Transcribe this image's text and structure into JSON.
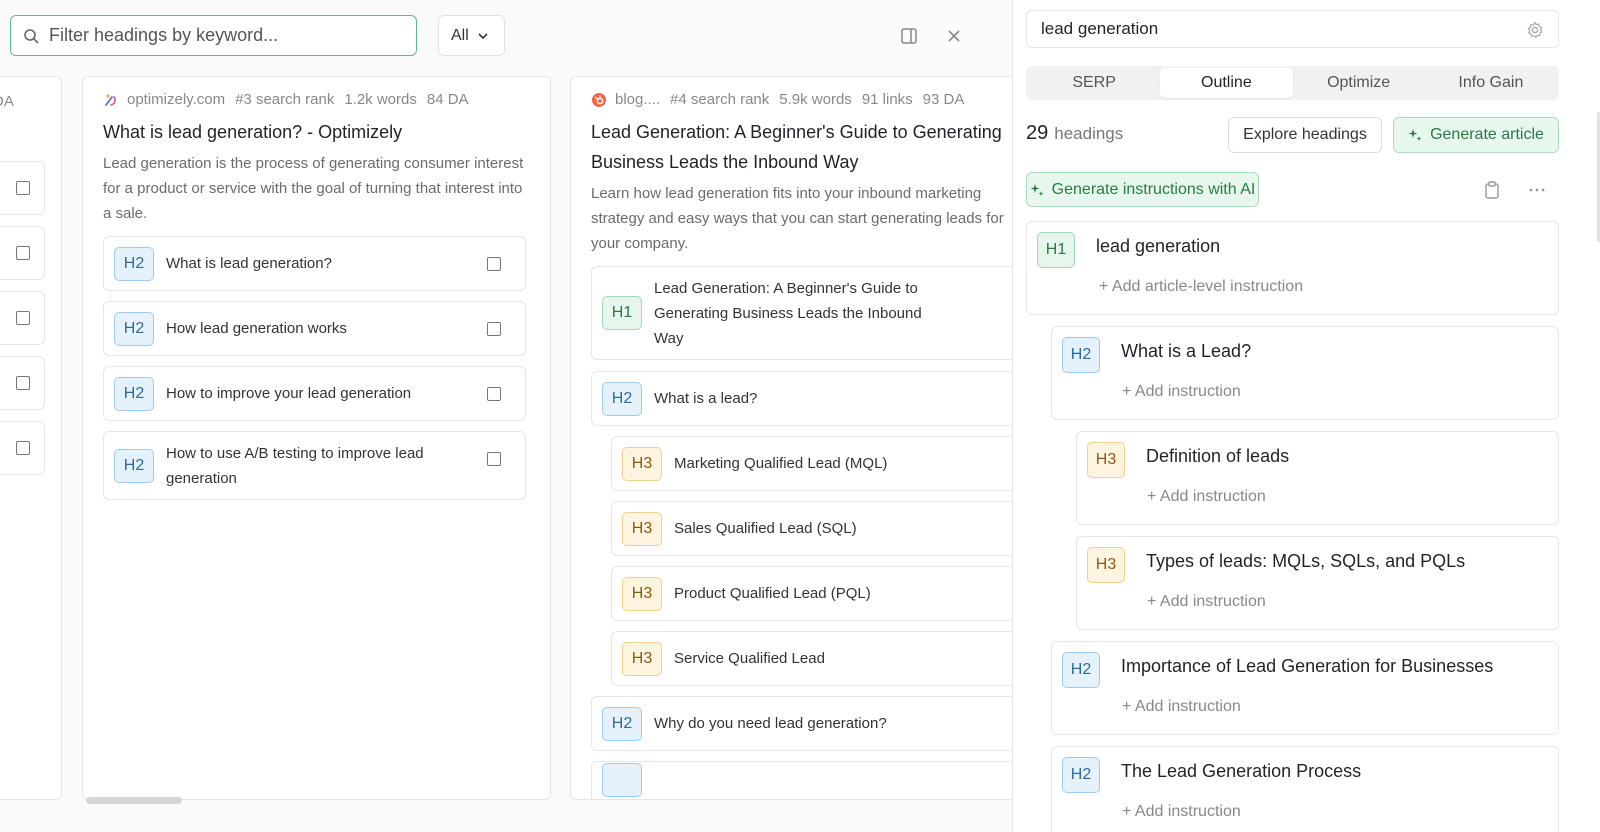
{
  "search": {
    "placeholder": "Filter headings by keyword...",
    "value": ""
  },
  "filter": {
    "selected": "All"
  },
  "stub_card": {
    "meta_fragment": "DA"
  },
  "sources": [
    {
      "domain": "optimizely.com",
      "rank": "#3 search rank",
      "words": "1.2k words",
      "da": "84 DA",
      "title": "What is lead generation? - Optimizely",
      "description": "Lead generation is the process of generating consumer interest for a product or service with the goal of turning that interest into a sale.",
      "headings": [
        {
          "level": "H2",
          "text": "What is lead generation?"
        },
        {
          "level": "H2",
          "text": "How lead generation works"
        },
        {
          "level": "H2",
          "text": "How to improve your lead generation"
        },
        {
          "level": "H2",
          "text": "How to use A/B testing to improve lead generation"
        }
      ]
    },
    {
      "domain": "blog....",
      "rank": "#4 search rank",
      "words": "5.9k words",
      "links": "91 links",
      "da": "93 DA",
      "title": "Lead Generation: A Beginner's Guide to Generating Business Leads the Inbound Way",
      "description": "Learn how lead generation fits into your inbound marketing strategy and easy ways that you can start generating leads for your company.",
      "headings": [
        {
          "level": "H1",
          "text": "Lead Generation: A Beginner's Guide to Generating Business Leads the Inbound Way"
        },
        {
          "level": "H2",
          "text": "What is a lead?"
        },
        {
          "level": "H3",
          "text": "Marketing Qualified Lead (MQL)"
        },
        {
          "level": "H3",
          "text": "Sales Qualified Lead (SQL)"
        },
        {
          "level": "H3",
          "text": "Product Qualified Lead (PQL)"
        },
        {
          "level": "H3",
          "text": "Service Qualified Lead"
        },
        {
          "level": "H2",
          "text": "Why do you need lead generation?"
        }
      ]
    }
  ],
  "panel": {
    "keyword": "lead generation",
    "tabs": [
      "SERP",
      "Outline",
      "Optimize",
      "Info Gain"
    ],
    "active_tab": "Outline",
    "heading_count": "29",
    "heading_count_label": "headings",
    "explore_label": "Explore headings",
    "generate_article_label": "Generate article",
    "generate_instructions_label": "Generate instructions with AI",
    "outline": [
      {
        "level": "H1",
        "text": "lead generation",
        "add": "+ Add article-level instruction"
      },
      {
        "level": "H2",
        "text": "What is a Lead?",
        "add": "+ Add instruction"
      },
      {
        "level": "H3",
        "text": "Definition of leads",
        "add": "+ Add instruction"
      },
      {
        "level": "H3",
        "text": "Types of leads: MQLs, SQLs, and PQLs",
        "add": "+ Add instruction"
      },
      {
        "level": "H2",
        "text": "Importance of Lead Generation for Businesses",
        "add": "+ Add instruction"
      },
      {
        "level": "H2",
        "text": "The Lead Generation Process",
        "add": "+ Add instruction"
      }
    ]
  },
  "colors": {
    "accent_green": "#2b7a46",
    "h1_bg": "#e6f6ec",
    "h2_bg": "#e5f1fb",
    "h3_bg": "#fff4df"
  }
}
